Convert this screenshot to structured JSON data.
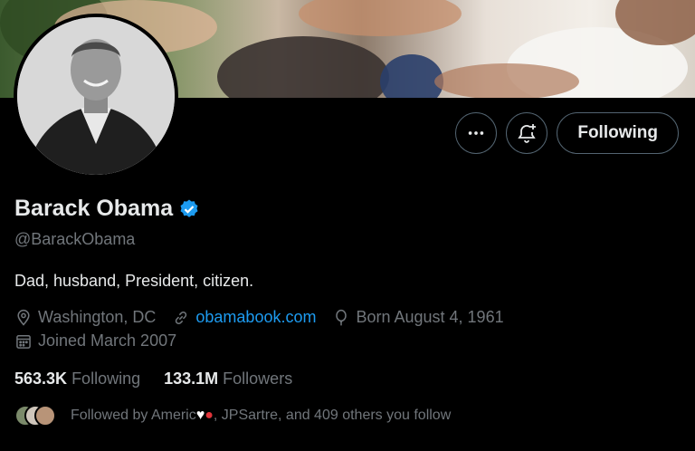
{
  "header": {
    "more_icon": "more-horizontal-icon",
    "notify_icon": "bell-plus-icon",
    "follow_button": "Following"
  },
  "profile": {
    "name": "Barack Obama",
    "verified_badge": "verified-badge-icon",
    "handle": "@BarackObama",
    "bio": "Dad, husband, President, citizen.",
    "location": "Washington, DC",
    "website": "obamabook.com",
    "birthday": "Born August 4, 1961",
    "joined": "Joined March 2007"
  },
  "stats": {
    "following_count": "563.3K",
    "following_label": "Following",
    "followers_count": "133.1M",
    "followers_label": "Followers"
  },
  "followed_by": {
    "prefix": "Followed by Americ",
    "suffix": ", JPSartre, and 409 others you follow"
  },
  "colors": {
    "accent": "#1d9bf0",
    "muted": "#71767b",
    "text": "#e7e9ea",
    "background": "#000000"
  }
}
